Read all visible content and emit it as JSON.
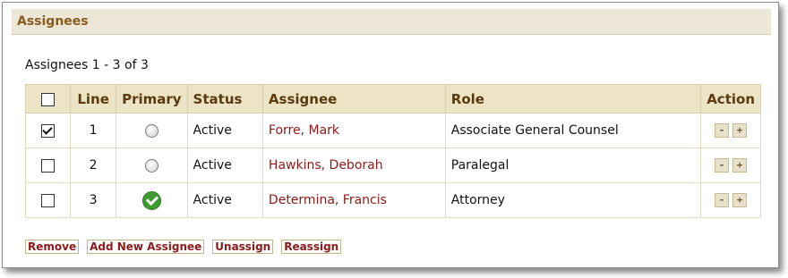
{
  "panel": {
    "title": "Assignees"
  },
  "summary": {
    "count_text": "Assignees 1 - 3 of 3"
  },
  "table": {
    "headers": {
      "line": "Line",
      "primary": "Primary",
      "status": "Status",
      "assignee": "Assignee",
      "role": "Role",
      "action": "Action"
    },
    "select_all_checked": false,
    "rows": [
      {
        "checked": true,
        "line": "1",
        "primary": false,
        "status": "Active",
        "assignee": "Forre, Mark",
        "role": "Associate General Counsel"
      },
      {
        "checked": false,
        "line": "2",
        "primary": false,
        "status": "Active",
        "assignee": "Hawkins, Deborah",
        "role": "Paralegal"
      },
      {
        "checked": false,
        "line": "3",
        "primary": true,
        "status": "Active",
        "assignee": "Determina, Francis",
        "role": "Attorney"
      }
    ],
    "action_labels": {
      "minus": "-",
      "plus": "+"
    }
  },
  "buttons": {
    "remove": "Remove",
    "add_new": "Add New Assignee",
    "unassign": "Unassign",
    "reassign": "Reassign"
  },
  "colors": {
    "header_bg": "#ece7d6",
    "title": "#8b5a1e",
    "link": "#8e1a1a",
    "primary_check": "#3e9c2e"
  },
  "icons": {
    "primary_selected": "green-check-circle-icon",
    "primary_unselected": "radio-button-icon"
  }
}
